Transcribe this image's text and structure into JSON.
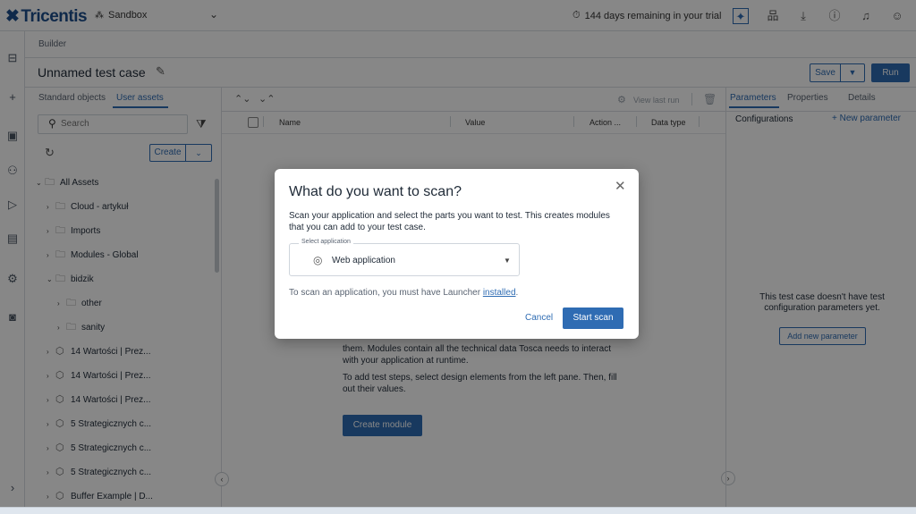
{
  "app": {
    "logo": "Tricentis",
    "workspace": "Sandbox",
    "trial": "144 days remaining in your trial"
  },
  "header": {
    "breadcrumb": "Builder",
    "title": "Unnamed test case",
    "save": "Save",
    "run": "Run"
  },
  "left": {
    "tabs": [
      "Standard objects",
      "User assets"
    ],
    "search_placeholder": "Search",
    "create": "Create",
    "tree": [
      {
        "label": "All Assets",
        "level": 0,
        "expanded": true,
        "kind": "folder"
      },
      {
        "label": "Cloud - artykuł",
        "level": 1,
        "expanded": false,
        "kind": "folder"
      },
      {
        "label": "Imports",
        "level": 1,
        "expanded": false,
        "kind": "folder"
      },
      {
        "label": "Modules - Global",
        "level": 1,
        "expanded": false,
        "kind": "folder"
      },
      {
        "label": "bidzik",
        "level": 1,
        "expanded": true,
        "kind": "folder"
      },
      {
        "label": "other",
        "level": 2,
        "expanded": false,
        "kind": "folder"
      },
      {
        "label": "sanity",
        "level": 2,
        "expanded": false,
        "kind": "folder"
      },
      {
        "label": "14 Wartości | Prez...",
        "level": 1,
        "expanded": false,
        "kind": "module"
      },
      {
        "label": "14 Wartości | Prez...",
        "level": 1,
        "expanded": false,
        "kind": "module"
      },
      {
        "label": "14 Wartości | Prez...",
        "level": 1,
        "expanded": false,
        "kind": "module"
      },
      {
        "label": "5 Strategicznych c...",
        "level": 1,
        "expanded": false,
        "kind": "module"
      },
      {
        "label": "5 Strategicznych c...",
        "level": 1,
        "expanded": false,
        "kind": "module"
      },
      {
        "label": "5 Strategicznych c...",
        "level": 1,
        "expanded": false,
        "kind": "module"
      },
      {
        "label": "Buffer Example | D...",
        "level": 1,
        "expanded": false,
        "kind": "module"
      }
    ]
  },
  "center": {
    "view_last_run": "View last run",
    "columns": [
      "Name",
      "Value",
      "Action ...",
      "Data type"
    ],
    "text1": "them. Modules contain all the technical data Tosca needs to interact with your application at runtime.",
    "text2": "To add test steps, select design elements from the left pane. Then, fill out their values.",
    "create_module": "Create module"
  },
  "right": {
    "tabs": [
      "Parameters",
      "Properties",
      "Details"
    ],
    "configurations": "Configurations",
    "new_parameter": "+ New parameter",
    "empty": "This test case doesn't have test configuration parameters yet.",
    "add_parameter": "Add new parameter"
  },
  "modal": {
    "title": "What do you want to scan?",
    "description": "Scan your application and select the parts you want to test. This creates modules that you can add to your test case.",
    "select_label": "Select application",
    "select_value": "Web application",
    "note_prefix": "To scan an application, you must have Launcher ",
    "note_link": "installed",
    "note_suffix": ".",
    "cancel": "Cancel",
    "start": "Start scan"
  },
  "colors": {
    "accent": "#2f6cb3",
    "brand": "#1e4f8c"
  }
}
